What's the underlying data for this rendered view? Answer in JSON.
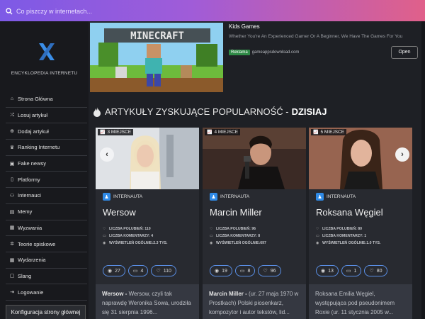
{
  "search": {
    "placeholder": "Co piszczy w internetach..."
  },
  "sidebar": {
    "brand": "ENCYKLOPEDIA INTERNETU",
    "items": [
      {
        "label": "Strona Główna",
        "icon": "home-icon"
      },
      {
        "label": "Losuj artykuł",
        "icon": "shuffle-icon"
      },
      {
        "label": "Dodaj artykuł",
        "icon": "plus-circle-icon"
      },
      {
        "label": "Ranking Internetu",
        "icon": "trophy-icon"
      },
      {
        "label": "Fake newsy",
        "icon": "fake-news-icon"
      },
      {
        "label": "Platformy",
        "icon": "platforms-icon"
      },
      {
        "label": "Internauci",
        "icon": "users-icon"
      },
      {
        "label": "Memy",
        "icon": "image-icon"
      },
      {
        "label": "Wyzwania",
        "icon": "calendar-icon"
      },
      {
        "label": "Teorie spiskowe",
        "icon": "gear-icon"
      },
      {
        "label": "Wydarzenia",
        "icon": "calendar-icon"
      },
      {
        "label": "Slang",
        "icon": "slang-icon"
      },
      {
        "label": "Logowanie",
        "icon": "sign-in-icon"
      }
    ],
    "config_button": "Konfiguracja strony głównej"
  },
  "ad": {
    "image_label": "MINECRAFT",
    "title": "Kids Games",
    "description": "Whether You're An Experienced Gamer Or A Beginner, We Have The Games For You",
    "tag": "Reklama",
    "domain": "gameappsdownload.com",
    "open": "Open"
  },
  "section": {
    "title": "ARTYKUŁY ZYSKUJĄCE POPULARNOŚĆ -",
    "highlight": "DZISIAJ"
  },
  "cards": [
    {
      "rank": "3 MIEJSCE",
      "category": "INTERNAUTA",
      "name": "Wersow",
      "likes_label": "LICZBA POLUBIEŃ: 110",
      "comments_label": "LICZBA KOMENTARZY: 4",
      "views_label": "WYŚWIETLEŃ OGÓLNIE:2.3 TYS.",
      "pill_views": "27",
      "pill_comments": "4",
      "pill_likes": "110",
      "excerpt_name": "Wersow -",
      "excerpt": " Wersow, czyli tak naprawdę Weronika Sowa, urodziła się 31 sierpnia 1996..."
    },
    {
      "rank": "4 MIEJSCE",
      "category": "INTERNAUTA",
      "name": "Marcin Miller",
      "likes_label": "LICZBA POLUBIEŃ: 96",
      "comments_label": "LICZBA KOMENTARZY: 8",
      "views_label": "WYŚWIETLEŃ OGÓLNIE:697",
      "pill_views": "19",
      "pill_comments": "8",
      "pill_likes": "96",
      "excerpt_name": "Marcin Miller -",
      "excerpt": " (ur. 27 maja 1970 w Prostkach) Polski piosenkarz, kompozytor i autor tekstów, lid..."
    },
    {
      "rank": "5 MIEJSCE",
      "category": "INTERNAUTA",
      "name": "Roksana Węgiel",
      "likes_label": "LICZBA POLUBIEŃ: 80",
      "comments_label": "LICZBA KOMENTARZY: 1",
      "views_label": "WYŚWIETLEŃ OGÓLNIE:1.0 TYS.",
      "pill_views": "13",
      "pill_comments": "1",
      "pill_likes": "80",
      "excerpt_name": "",
      "excerpt": "Roksana Emilia Węgiel, występująca pod pseudonimem Roxie (ur. 11 stycznia 2005 w..."
    }
  ]
}
